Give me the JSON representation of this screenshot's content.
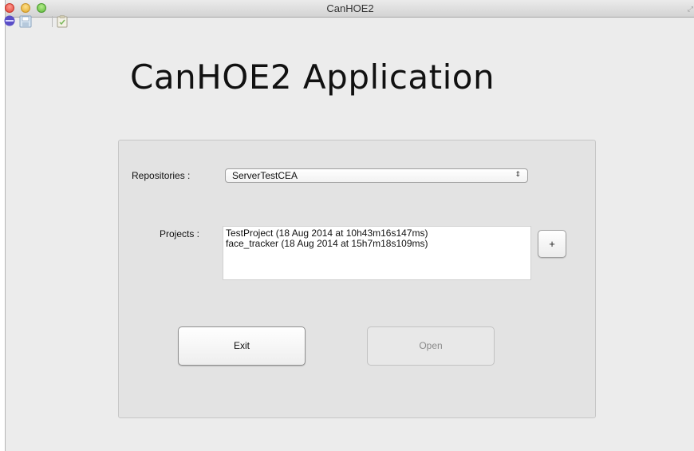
{
  "window": {
    "title": "CanHOE2"
  },
  "toolbar": {
    "icons": [
      "stop-icon",
      "save-icon",
      "clipboard-icon"
    ]
  },
  "app": {
    "heading": "CanHOE2 Application"
  },
  "form": {
    "repositories_label": "Repositories :",
    "repository_selected": "ServerTestCEA",
    "projects_label": "Projects :",
    "projects": [
      "TestProject (18 Aug 2014 at 10h43m16s147ms)",
      "face_tracker (18 Aug 2014 at 15h7m18s109ms)"
    ],
    "add_label": "+",
    "exit_label": "Exit",
    "open_label": "Open"
  }
}
